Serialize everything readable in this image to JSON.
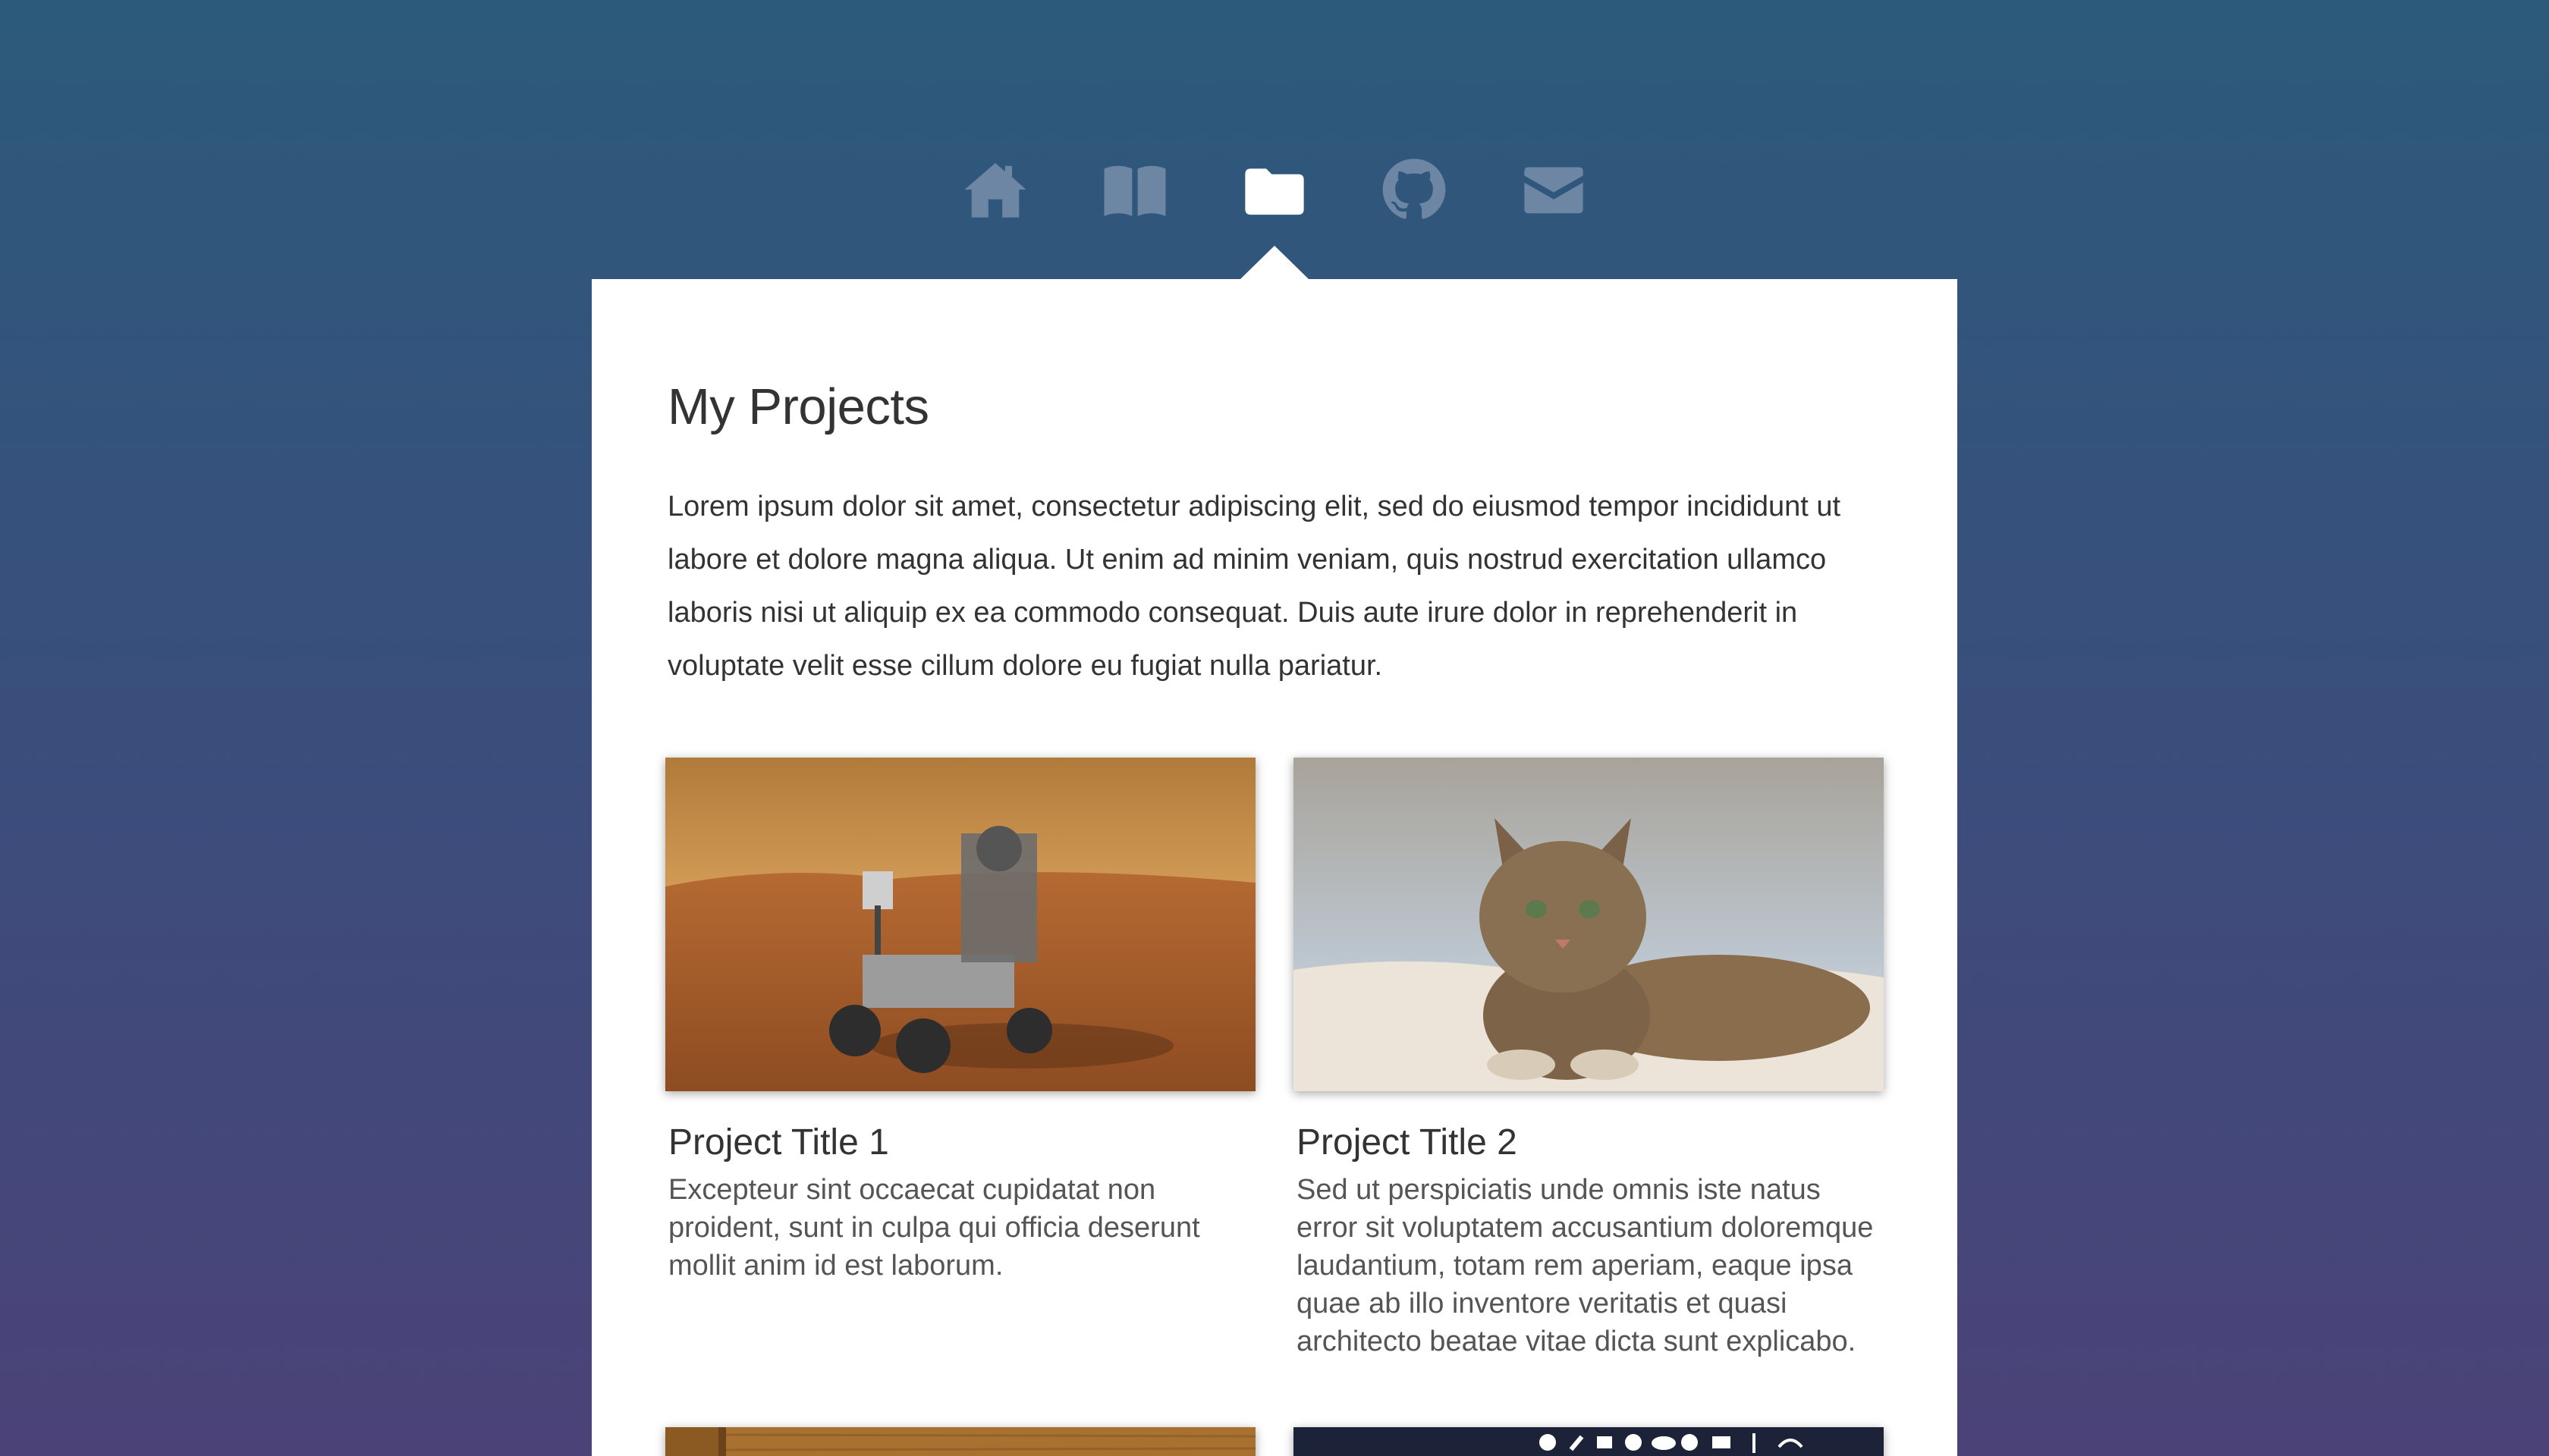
{
  "nav": {
    "items": [
      {
        "icon": "home-icon",
        "active": false
      },
      {
        "icon": "book-icon",
        "active": false
      },
      {
        "icon": "folder-icon",
        "active": true
      },
      {
        "icon": "github-icon",
        "active": false
      },
      {
        "icon": "envelope-icon",
        "active": false
      }
    ]
  },
  "page": {
    "title": "My Projects",
    "intro": "Lorem ipsum dolor sit amet, consectetur adipiscing elit, sed do eiusmod tempor incididunt ut labore et dolore magna aliqua. Ut enim ad minim veniam, quis nostrud exercitation ullamco laboris nisi ut aliquip ex ea commodo consequat. Duis aute irure dolor in reprehenderit in voluptate velit esse cillum dolore eu fugiat nulla pariatur."
  },
  "projects": [
    {
      "title": "Project Title 1",
      "description": "Excepteur sint occaecat cupidatat non proident, sunt in culpa qui officia deserunt mollit anim id est laborum.",
      "image": "mars-rover-image"
    },
    {
      "title": "Project Title 2",
      "description": "Sed ut perspiciatis unde omnis iste natus error sit voluptatem accusantium doloremque laudantium, totam rem aperiam, eaque ipsa quae ab illo inventore veritatis et quasi architecto beatae vitae dicta sunt explicabo.",
      "image": "tabby-cat-image"
    },
    {
      "image": "wood-texture-image"
    },
    {
      "image": "menu-bar-screenshot-image"
    }
  ],
  "colors": {
    "gradient_top": "#2c5a7b",
    "gradient_bottom": "#4b4278",
    "nav_icon_inactive": "#6c86a3",
    "nav_icon_active": "#ffffff",
    "card": "#ffffff",
    "text": "#333333"
  }
}
